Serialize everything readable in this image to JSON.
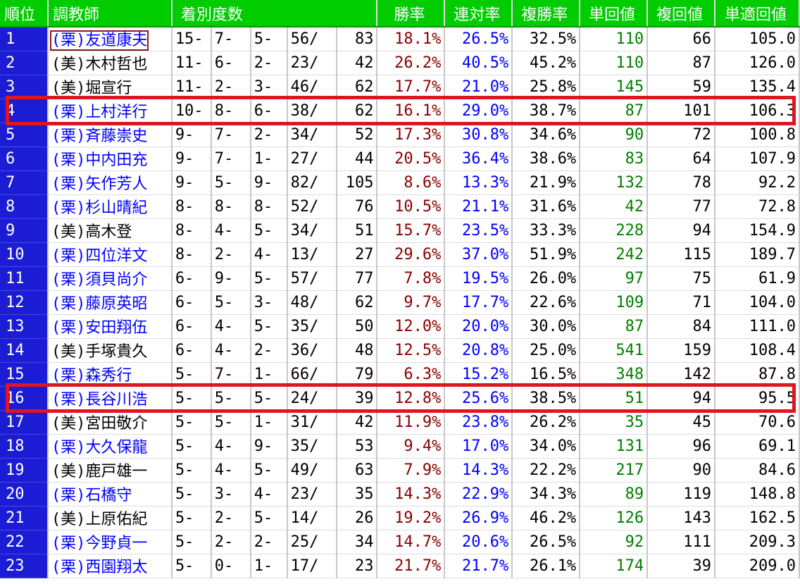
{
  "headers": [
    "順位",
    "調教師",
    "着別度数",
    "勝率",
    "連対率",
    "複勝率",
    "単回値",
    "複回値",
    "単適回値"
  ],
  "rows": [
    {
      "rank": "1",
      "name": "(栗)友道康夫",
      "link": true,
      "boxed": true,
      "record": [
        "15-",
        "7-",
        "5-",
        "56/",
        "83"
      ],
      "win": "18.1%",
      "ren": "26.5%",
      "fuku": "32.5%",
      "tan": "110",
      "fkr": "66",
      "teki": "105.0"
    },
    {
      "rank": "2",
      "name": "(美)木村哲也",
      "link": false,
      "record": [
        "11-",
        "6-",
        "2-",
        "23/",
        "42"
      ],
      "win": "26.2%",
      "ren": "40.5%",
      "fuku": "45.2%",
      "tan": "110",
      "fkr": "87",
      "teki": "126.0"
    },
    {
      "rank": "3",
      "name": "(美)堀宣行",
      "link": false,
      "record": [
        "11-",
        "2-",
        "3-",
        "46/",
        "62"
      ],
      "win": "17.7%",
      "ren": "21.0%",
      "fuku": "25.8%",
      "tan": "145",
      "fkr": "59",
      "teki": "135.4"
    },
    {
      "rank": "4",
      "name": "(栗)上村洋行",
      "link": true,
      "record": [
        "10-",
        "8-",
        "6-",
        "38/",
        "62"
      ],
      "win": "16.1%",
      "ren": "29.0%",
      "fuku": "38.7%",
      "tan": "87",
      "fkr": "101",
      "teki": "106.3"
    },
    {
      "rank": "5",
      "name": "(栗)斉藤崇史",
      "link": true,
      "record": [
        "9-",
        "7-",
        "2-",
        "34/",
        "52"
      ],
      "win": "17.3%",
      "ren": "30.8%",
      "fuku": "34.6%",
      "tan": "90",
      "fkr": "72",
      "teki": "100.8"
    },
    {
      "rank": "6",
      "name": "(栗)中内田充",
      "link": true,
      "record": [
        "9-",
        "7-",
        "1-",
        "27/",
        "44"
      ],
      "win": "20.5%",
      "ren": "36.4%",
      "fuku": "38.6%",
      "tan": "83",
      "fkr": "64",
      "teki": "107.9"
    },
    {
      "rank": "7",
      "name": "(栗)矢作芳人",
      "link": true,
      "record": [
        "9-",
        "5-",
        "9-",
        "82/",
        "105"
      ],
      "win": "8.6%",
      "ren": "13.3%",
      "fuku": "21.9%",
      "tan": "132",
      "fkr": "78",
      "teki": "92.2"
    },
    {
      "rank": "8",
      "name": "(栗)杉山晴紀",
      "link": true,
      "record": [
        "8-",
        "8-",
        "8-",
        "52/",
        "76"
      ],
      "win": "10.5%",
      "ren": "21.1%",
      "fuku": "31.6%",
      "tan": "42",
      "fkr": "77",
      "teki": "72.8"
    },
    {
      "rank": "9",
      "name": "(美)高木登",
      "link": false,
      "record": [
        "8-",
        "4-",
        "5-",
        "34/",
        "51"
      ],
      "win": "15.7%",
      "ren": "23.5%",
      "fuku": "33.3%",
      "tan": "228",
      "fkr": "94",
      "teki": "154.9"
    },
    {
      "rank": "10",
      "name": "(栗)四位洋文",
      "link": true,
      "record": [
        "8-",
        "2-",
        "4-",
        "13/",
        "27"
      ],
      "win": "29.6%",
      "ren": "37.0%",
      "fuku": "51.9%",
      "tan": "242",
      "fkr": "115",
      "teki": "189.7"
    },
    {
      "rank": "11",
      "name": "(栗)須貝尚介",
      "link": true,
      "record": [
        "6-",
        "9-",
        "5-",
        "57/",
        "77"
      ],
      "win": "7.8%",
      "ren": "19.5%",
      "fuku": "26.0%",
      "tan": "97",
      "fkr": "75",
      "teki": "61.9"
    },
    {
      "rank": "12",
      "name": "(栗)藤原英昭",
      "link": true,
      "record": [
        "6-",
        "5-",
        "3-",
        "48/",
        "62"
      ],
      "win": "9.7%",
      "ren": "17.7%",
      "fuku": "22.6%",
      "tan": "109",
      "fkr": "71",
      "teki": "104.0"
    },
    {
      "rank": "13",
      "name": "(栗)安田翔伍",
      "link": true,
      "record": [
        "6-",
        "4-",
        "5-",
        "35/",
        "50"
      ],
      "win": "12.0%",
      "ren": "20.0%",
      "fuku": "30.0%",
      "tan": "87",
      "fkr": "84",
      "teki": "111.0"
    },
    {
      "rank": "14",
      "name": "(美)手塚貴久",
      "link": false,
      "record": [
        "6-",
        "4-",
        "2-",
        "36/",
        "48"
      ],
      "win": "12.5%",
      "ren": "20.8%",
      "fuku": "25.0%",
      "tan": "541",
      "fkr": "159",
      "teki": "108.4"
    },
    {
      "rank": "15",
      "name": "(栗)森秀行",
      "link": true,
      "record": [
        "5-",
        "7-",
        "1-",
        "66/",
        "79"
      ],
      "win": "6.3%",
      "ren": "15.2%",
      "fuku": "16.5%",
      "tan": "348",
      "fkr": "142",
      "teki": "87.8"
    },
    {
      "rank": "16",
      "name": "(栗)長谷川浩",
      "link": true,
      "record": [
        "5-",
        "5-",
        "5-",
        "24/",
        "39"
      ],
      "win": "12.8%",
      "ren": "25.6%",
      "fuku": "38.5%",
      "tan": "51",
      "fkr": "94",
      "teki": "95.5"
    },
    {
      "rank": "17",
      "name": "(美)宮田敬介",
      "link": false,
      "record": [
        "5-",
        "5-",
        "1-",
        "31/",
        "42"
      ],
      "win": "11.9%",
      "ren": "23.8%",
      "fuku": "26.2%",
      "tan": "35",
      "fkr": "45",
      "teki": "70.6"
    },
    {
      "rank": "18",
      "name": "(栗)大久保龍",
      "link": true,
      "record": [
        "5-",
        "4-",
        "9-",
        "35/",
        "53"
      ],
      "win": "9.4%",
      "ren": "17.0%",
      "fuku": "34.0%",
      "tan": "131",
      "fkr": "96",
      "teki": "69.1"
    },
    {
      "rank": "19",
      "name": "(美)鹿戸雄一",
      "link": false,
      "record": [
        "5-",
        "4-",
        "5-",
        "49/",
        "63"
      ],
      "win": "7.9%",
      "ren": "14.3%",
      "fuku": "22.2%",
      "tan": "217",
      "fkr": "90",
      "teki": "84.6"
    },
    {
      "rank": "20",
      "name": "(栗)石橋守",
      "link": true,
      "record": [
        "5-",
        "3-",
        "4-",
        "23/",
        "35"
      ],
      "win": "14.3%",
      "ren": "22.9%",
      "fuku": "34.3%",
      "tan": "89",
      "fkr": "119",
      "teki": "148.8"
    },
    {
      "rank": "21",
      "name": "(美)上原佑紀",
      "link": false,
      "record": [
        "5-",
        "2-",
        "5-",
        "14/",
        "26"
      ],
      "win": "19.2%",
      "ren": "26.9%",
      "fuku": "46.2%",
      "tan": "126",
      "fkr": "143",
      "teki": "162.5"
    },
    {
      "rank": "22",
      "name": "(栗)今野貞一",
      "link": true,
      "record": [
        "5-",
        "2-",
        "2-",
        "25/",
        "34"
      ],
      "win": "14.7%",
      "ren": "20.6%",
      "fuku": "26.5%",
      "tan": "92",
      "fkr": "111",
      "teki": "209.3"
    },
    {
      "rank": "23",
      "name": "(栗)西園翔太",
      "link": true,
      "record": [
        "5-",
        "0-",
        "1-",
        "17/",
        "23"
      ],
      "win": "21.7%",
      "ren": "21.7%",
      "fuku": "26.1%",
      "tan": "174",
      "fkr": "39",
      "teki": "209.0"
    }
  ],
  "highlighted_ranks": [
    "4",
    "16"
  ],
  "colors": {
    "header_bg": "#00cc00",
    "rank_bg": "#1c1cd4",
    "highlight": "#e0161f",
    "win_text": "#8b0000",
    "link_text": "#0000ff",
    "tan_text": "#008000"
  }
}
